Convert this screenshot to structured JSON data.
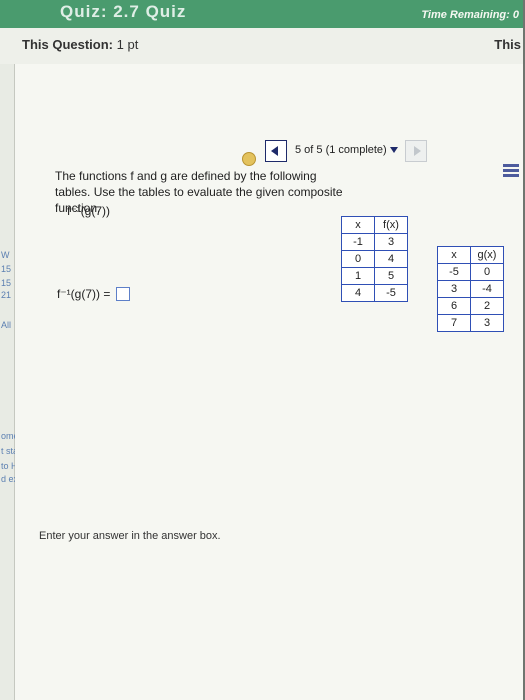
{
  "header": {
    "title": "Quiz: 2.7 Quiz",
    "time_remaining": "Time Remaining: 0"
  },
  "question_bar": {
    "label": "This Question:",
    "points": "1 pt",
    "right_text": "This"
  },
  "navigation": {
    "status": "5 of 5 (1 complete)"
  },
  "instruction": "The functions f and g are defined by the following tables. Use the tables to evaluate the given composite function.",
  "composite_function": "f⁻¹(g(7))",
  "answer_label": "f⁻¹(g(7)) =",
  "footer_text": "Enter your answer in the answer box.",
  "left_fragments": [
    "W",
    "15",
    "15",
    "21",
    "All",
    "ome",
    "t sta",
    "to Ho",
    "d extr"
  ],
  "f_table": {
    "headers": [
      "x",
      "f(x)"
    ],
    "rows": [
      [
        "-1",
        "3"
      ],
      [
        "0",
        "4"
      ],
      [
        "1",
        "5"
      ],
      [
        "4",
        "-5"
      ]
    ]
  },
  "g_table": {
    "headers": [
      "x",
      "g(x)"
    ],
    "rows": [
      [
        "-5",
        "0"
      ],
      [
        "3",
        "-4"
      ],
      [
        "6",
        "2"
      ],
      [
        "7",
        "3"
      ]
    ]
  }
}
